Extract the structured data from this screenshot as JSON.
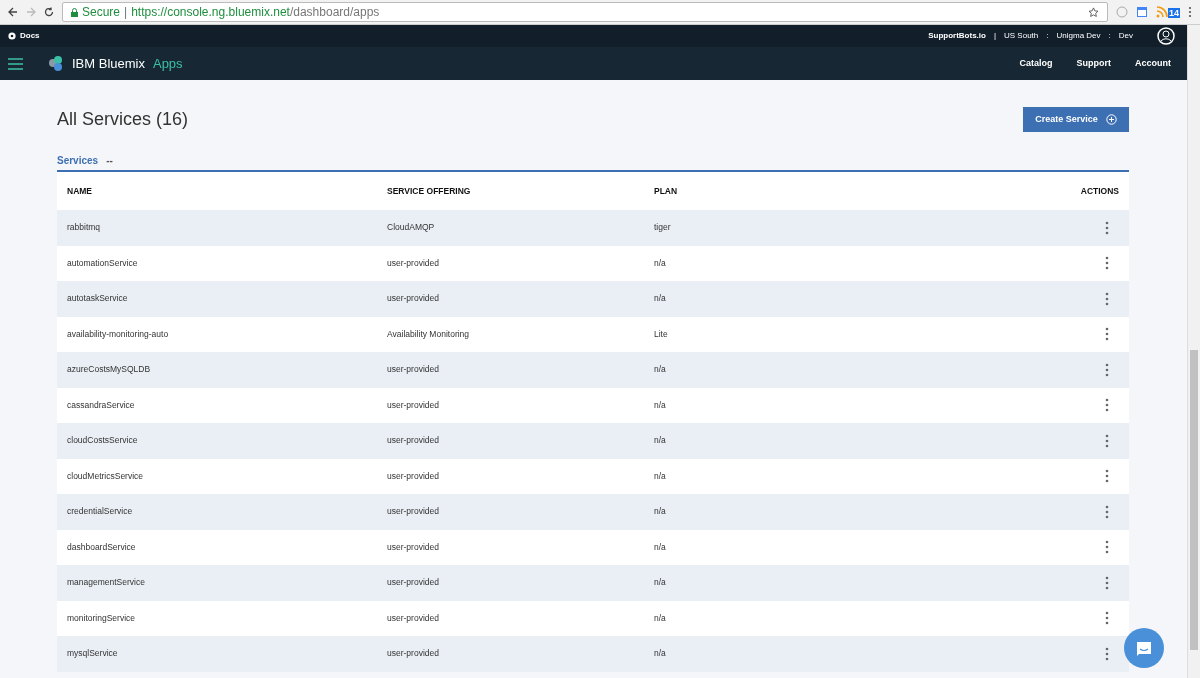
{
  "browser": {
    "secure_label": "Secure",
    "divider": "|",
    "url_host": "https://console.ng.bluemix.net",
    "url_path": "/dashboard/apps",
    "extension_badge": "14"
  },
  "top_bar": {
    "docs": "Docs",
    "org": "SupportBots.io",
    "separator": "|",
    "region": "US South",
    "colon_1": ":",
    "space": "Unigma Dev",
    "colon_2": ":",
    "env": "Dev"
  },
  "nav": {
    "brand": "IBM Bluemix",
    "section": "Apps",
    "links": [
      "Catalog",
      "Support",
      "Account"
    ]
  },
  "page": {
    "title": "All Services (16)",
    "create_button": "Create Service"
  },
  "group": {
    "title": "Services",
    "suffix": "--"
  },
  "table": {
    "columns": [
      "NAME",
      "SERVICE OFFERING",
      "PLAN",
      "ACTIONS"
    ],
    "rows": [
      {
        "name": "rabbitmq",
        "offering": "CloudAMQP",
        "plan": "tiger"
      },
      {
        "name": "automationService",
        "offering": "user-provided",
        "plan": "n/a"
      },
      {
        "name": "autotaskService",
        "offering": "user-provided",
        "plan": "n/a"
      },
      {
        "name": "availability-monitoring-auto",
        "offering": "Availability Monitoring",
        "plan": "Lite"
      },
      {
        "name": "azureCostsMySQLDB",
        "offering": "user-provided",
        "plan": "n/a"
      },
      {
        "name": "cassandraService",
        "offering": "user-provided",
        "plan": "n/a"
      },
      {
        "name": "cloudCostsService",
        "offering": "user-provided",
        "plan": "n/a"
      },
      {
        "name": "cloudMetricsService",
        "offering": "user-provided",
        "plan": "n/a"
      },
      {
        "name": "credentialService",
        "offering": "user-provided",
        "plan": "n/a"
      },
      {
        "name": "dashboardService",
        "offering": "user-provided",
        "plan": "n/a"
      },
      {
        "name": "managementService",
        "offering": "user-provided",
        "plan": "n/a"
      },
      {
        "name": "monitoringService",
        "offering": "user-provided",
        "plan": "n/a"
      },
      {
        "name": "mysqlService",
        "offering": "user-provided",
        "plan": "n/a"
      }
    ]
  }
}
